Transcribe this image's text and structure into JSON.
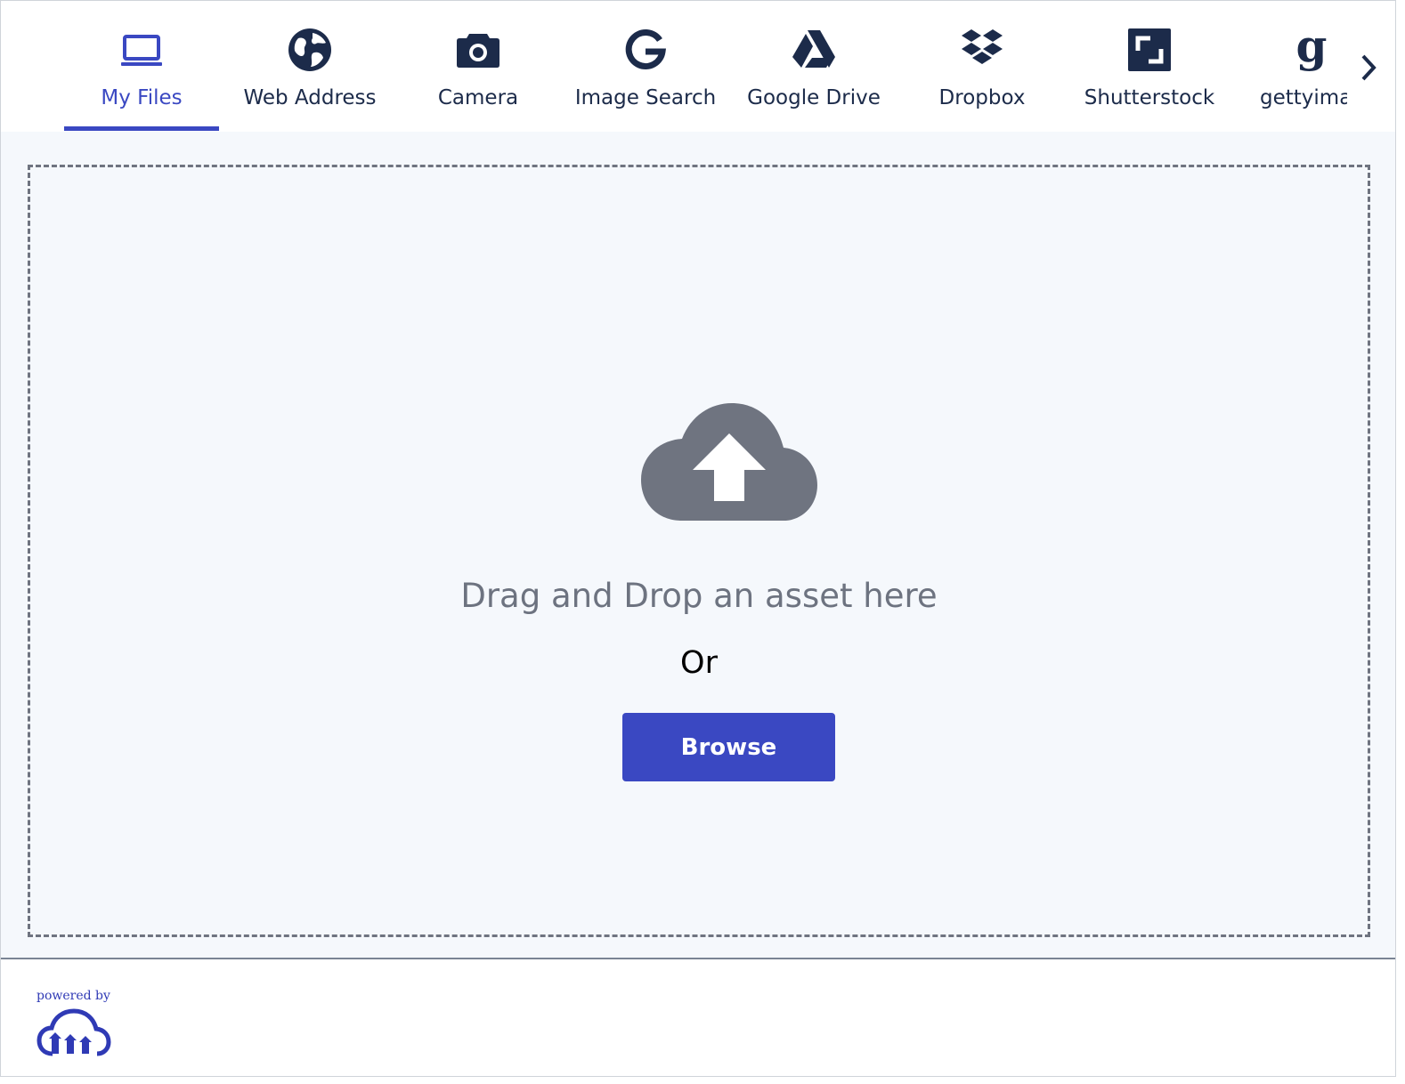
{
  "tabs": [
    {
      "label": "My Files",
      "icon": "laptop-icon",
      "active": true
    },
    {
      "label": "Web Address",
      "icon": "globe-icon",
      "active": false
    },
    {
      "label": "Camera",
      "icon": "camera-icon",
      "active": false
    },
    {
      "label": "Image Search",
      "icon": "google-icon",
      "active": false
    },
    {
      "label": "Google Drive",
      "icon": "google-drive-icon",
      "active": false
    },
    {
      "label": "Dropbox",
      "icon": "dropbox-icon",
      "active": false
    },
    {
      "label": "Shutterstock",
      "icon": "shutterstock-icon",
      "active": false
    },
    {
      "label": "gettyima",
      "icon": "gettyimages-icon",
      "active": false
    }
  ],
  "dropzone": {
    "message": "Drag and Drop an asset here",
    "or": "Or",
    "browse_label": "Browse",
    "icon": "cloud-upload-icon"
  },
  "footer": {
    "powered_by": "powered by",
    "logo_icon": "cloudinary-logo-icon"
  },
  "colors": {
    "accent": "#3a48c2",
    "nav_text": "#1c2b4a",
    "muted": "#6d7380",
    "background": "#f5f8fc"
  }
}
